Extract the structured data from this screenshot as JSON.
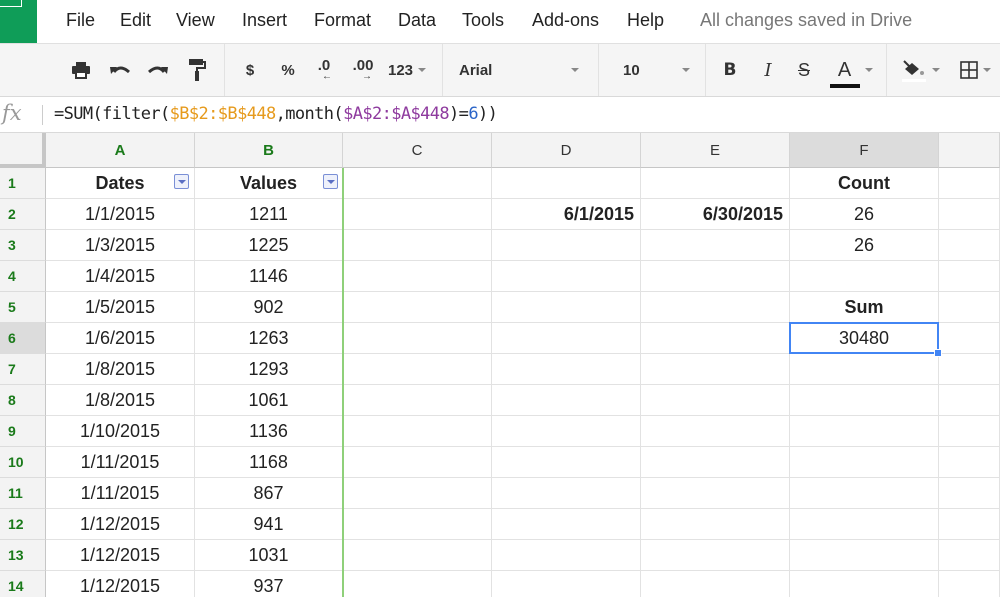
{
  "menu": {
    "items": [
      "File",
      "Edit",
      "View",
      "Insert",
      "Format",
      "Data",
      "Tools",
      "Add-ons",
      "Help"
    ],
    "status": "All changes saved in Drive"
  },
  "toolbar": {
    "print_icon": "print-icon",
    "undo_icon": "undo-icon",
    "redo_icon": "redo-icon",
    "paint_format_icon": "paint-format-icon",
    "currency_label": "$",
    "percent_label": "%",
    "decrease_decimal_label": ".0",
    "increase_decimal_label": ".00",
    "more_formats_label": "123",
    "font_name": "Arial",
    "font_size": "10",
    "bold_label": "B",
    "italic_label": "I",
    "strikethrough_label": "S",
    "text_color_label": "A",
    "fill_color_icon": "fill-color-icon",
    "borders_icon": "borders-icon"
  },
  "formula_bar": {
    "fx_label": "fx",
    "parts": {
      "p1": "=SUM(filter(",
      "r1": "$B$2:$B$448",
      "p2": ",month(",
      "r2": "$A$2:$A$448",
      "p3": ")=",
      "n": "6",
      "p4": "))"
    }
  },
  "grid": {
    "columns": [
      "A",
      "B",
      "C",
      "D",
      "E",
      "F"
    ],
    "active_column": "F",
    "active_row": "6",
    "selected_cell": "F6",
    "rows": [
      {
        "n": "1",
        "A": "Dates",
        "B": "Values",
        "C": "",
        "D": "",
        "E": "",
        "F": "Count"
      },
      {
        "n": "2",
        "A": "1/1/2015",
        "B": "1211",
        "C": "",
        "D": "6/1/2015",
        "E": "6/30/2015",
        "F": "26"
      },
      {
        "n": "3",
        "A": "1/3/2015",
        "B": "1225",
        "C": "",
        "D": "",
        "E": "",
        "F": "26"
      },
      {
        "n": "4",
        "A": "1/4/2015",
        "B": "1146",
        "C": "",
        "D": "",
        "E": "",
        "F": ""
      },
      {
        "n": "5",
        "A": "1/5/2015",
        "B": "902",
        "C": "",
        "D": "",
        "E": "",
        "F": "Sum"
      },
      {
        "n": "6",
        "A": "1/6/2015",
        "B": "1263",
        "C": "",
        "D": "",
        "E": "",
        "F": "30480"
      },
      {
        "n": "7",
        "A": "1/8/2015",
        "B": "1293",
        "C": "",
        "D": "",
        "E": "",
        "F": ""
      },
      {
        "n": "8",
        "A": "1/8/2015",
        "B": "1061",
        "C": "",
        "D": "",
        "E": "",
        "F": ""
      },
      {
        "n": "9",
        "A": "1/10/2015",
        "B": "1136",
        "C": "",
        "D": "",
        "E": "",
        "F": ""
      },
      {
        "n": "10",
        "A": "1/11/2015",
        "B": "1168",
        "C": "",
        "D": "",
        "E": "",
        "F": ""
      },
      {
        "n": "11",
        "A": "1/11/2015",
        "B": "867",
        "C": "",
        "D": "",
        "E": "",
        "F": ""
      },
      {
        "n": "12",
        "A": "1/12/2015",
        "B": "941",
        "C": "",
        "D": "",
        "E": "",
        "F": ""
      },
      {
        "n": "13",
        "A": "1/12/2015",
        "B": "1031",
        "C": "",
        "D": "",
        "E": "",
        "F": ""
      },
      {
        "n": "14",
        "A": "1/12/2015",
        "B": "937",
        "C": "",
        "D": "",
        "E": "",
        "F": ""
      }
    ]
  }
}
